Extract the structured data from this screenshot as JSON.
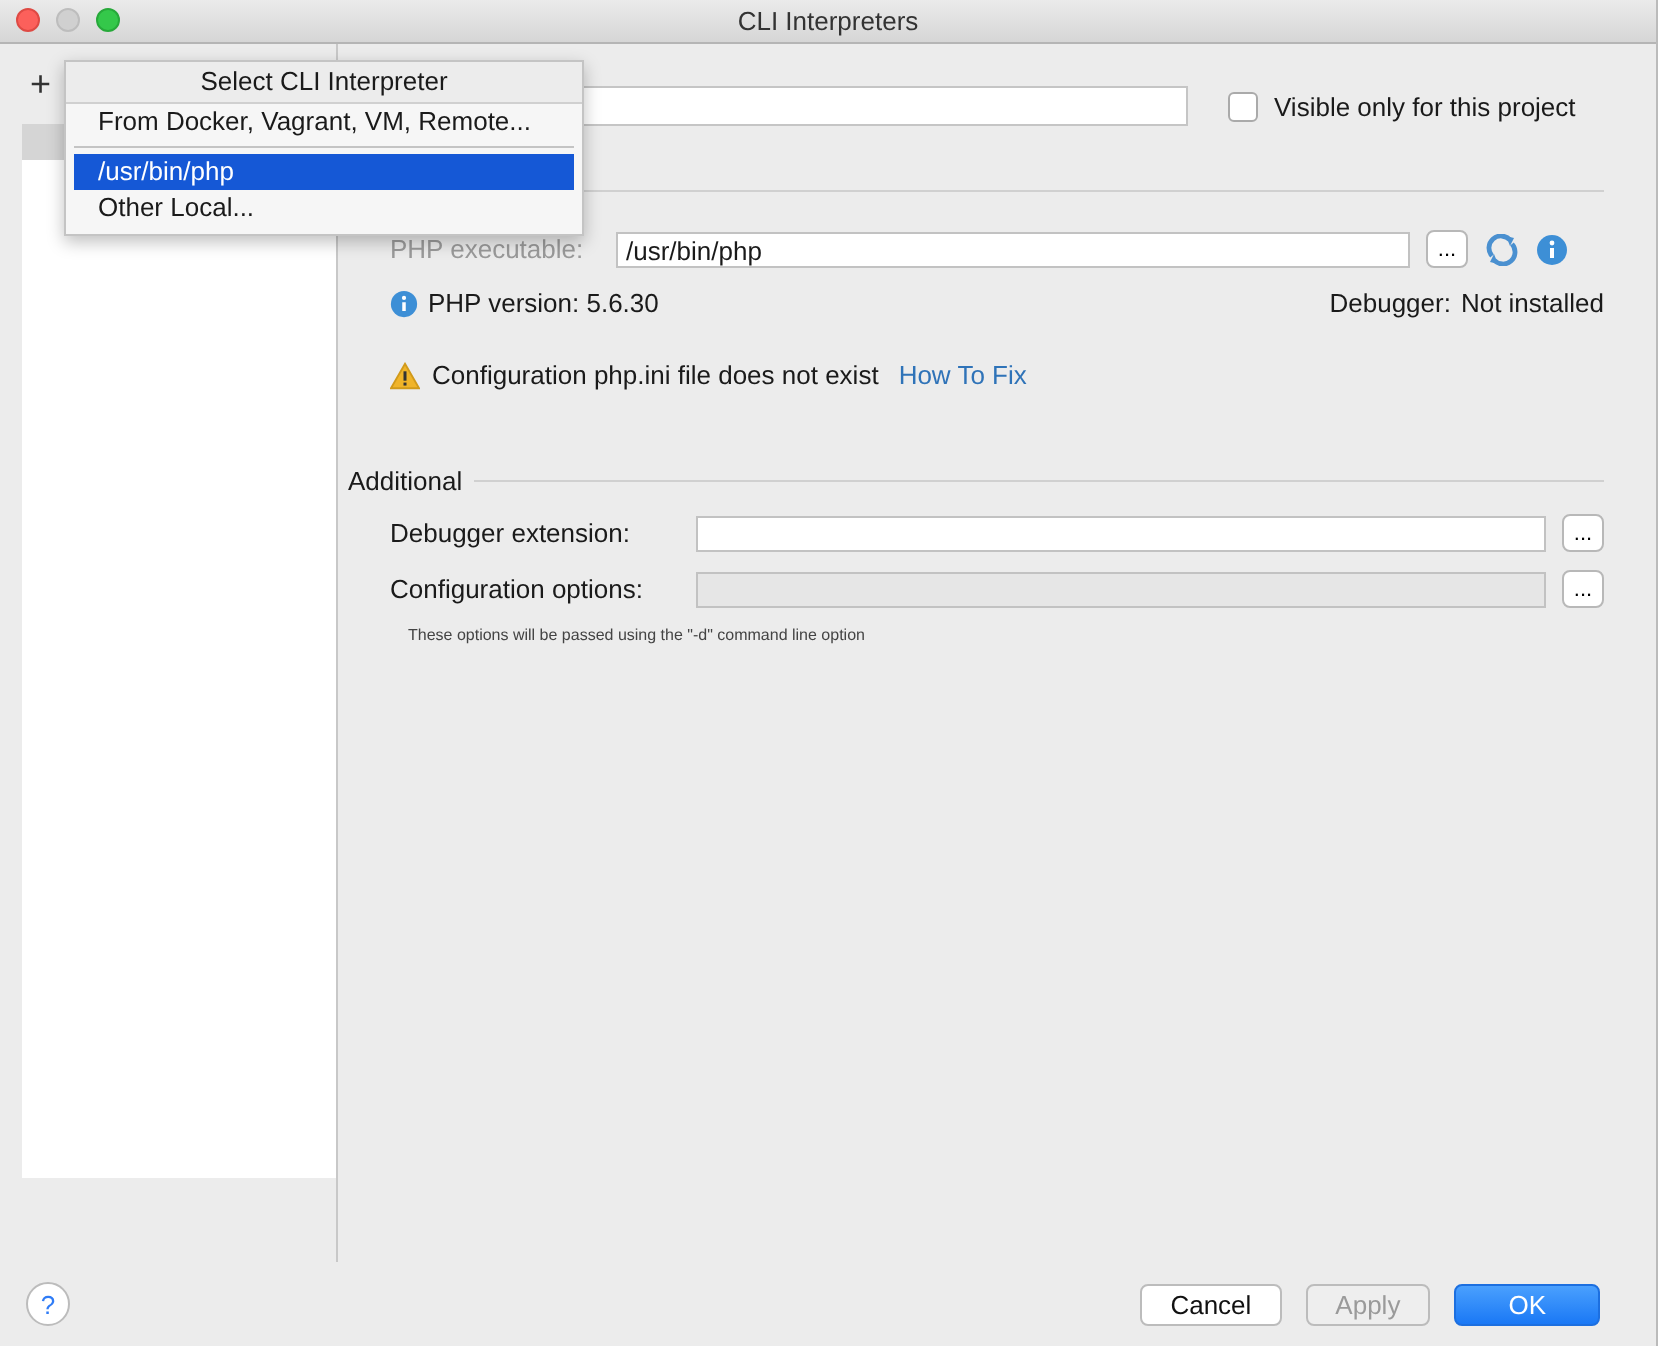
{
  "window": {
    "title": "CLI Interpreters"
  },
  "toolbar": {
    "buttons": [
      {
        "label": "+"
      }
    ]
  },
  "sidebar": {
    "items": [
      {
        "selected": true
      }
    ]
  },
  "popup": {
    "title": "Select CLI Interpreter",
    "items": [
      {
        "label": "From Docker, Vagrant, VM, Remote...",
        "selected": false,
        "kind": "item"
      },
      {
        "kind": "separator"
      },
      {
        "label": "/usr/bin/php",
        "selected": true,
        "kind": "item"
      },
      {
        "label": "Other Local...",
        "selected": false,
        "kind": "item"
      }
    ]
  },
  "visible_only": {
    "label": "Visible only for this project",
    "checked": false
  },
  "general": {
    "executable_label": "PHP executable:",
    "executable_value": "/usr/bin/php",
    "browse": "...",
    "php_version": "PHP version: 5.6.30",
    "debugger_label": "Debugger:",
    "debugger_value": "Not installed",
    "warning": "Configuration php.ini file does not exist",
    "fix_link": "How To Fix"
  },
  "additional": {
    "title": "Additional",
    "rows": [
      {
        "label": "Debugger extension:",
        "value": "",
        "disabled": false,
        "browse": "..."
      },
      {
        "label": "Configuration options:",
        "value": "",
        "disabled": true,
        "browse": "..."
      }
    ],
    "hint": "These options will be passed using the \"-d\" command line option"
  },
  "footer": {
    "help": "?",
    "buttons": [
      {
        "label": "Cancel",
        "kind": "normal",
        "disabled": false
      },
      {
        "label": "Apply",
        "kind": "normal",
        "disabled": true
      },
      {
        "label": "OK",
        "kind": "default",
        "disabled": false
      }
    ]
  }
}
